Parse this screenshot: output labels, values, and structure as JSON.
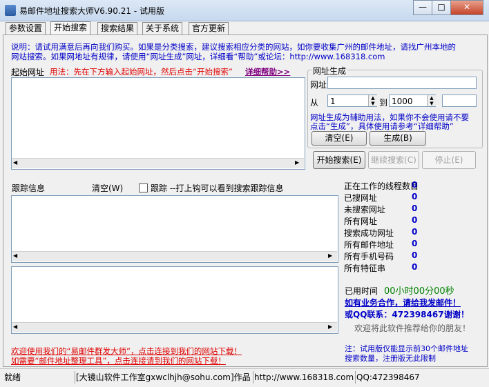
{
  "window": {
    "title": "易邮件地址搜索大师V6.90.21 - 试用版",
    "minimize": "—",
    "maximize": "□",
    "close": "✕"
  },
  "tabs": [
    {
      "label": "参数设置"
    },
    {
      "label": "开始搜索"
    },
    {
      "label": "搜索结果"
    },
    {
      "label": "关于系统"
    },
    {
      "label": "官方更新"
    }
  ],
  "notice": {
    "line1": "说明：请试用满意后再向我们购买。如果是分类搜索，建议搜索相应分类的网站，如你要收集广州的邮件地址，请找广州本地的",
    "line2": "网站搜索。如果网地址有规律，请使用“网址生成”网址，详细看“帮助”或论坛：http://www.168318.com"
  },
  "start_url": {
    "label": "起始网址",
    "usage": "用法：先在下方输入起始网址，然后点击“开始搜索”",
    "help_link": "详细帮助>>"
  },
  "url_gen": {
    "group_title": "网址生成",
    "url_label": "网址",
    "url_value": "",
    "from_label": "从",
    "from_value": "1",
    "to_label": "到",
    "to_value": "1000",
    "extra_value": "",
    "hint1": "网址生成为辅助用法，如果你不会使用请不要",
    "hint2": "点击“生成”，具体使用请参考“详细帮助”",
    "clear_btn": "清空(E)",
    "gen_btn": "生成(B)"
  },
  "controls": {
    "start_btn": "开始搜索(E)",
    "continue_btn": "继续搜索(C)",
    "stop_btn": "停止(E)"
  },
  "trace": {
    "label": "跟踪信息",
    "clear": "清空(W)",
    "checkbox_label": "跟踪 --打上钩可以看到搜索跟踪信息",
    "checked": false
  },
  "counters": [
    {
      "label": "正在工作的线程数目",
      "value": "0"
    },
    {
      "label": "已搜网址",
      "value": "0"
    },
    {
      "label": "未搜索网址",
      "value": "0"
    },
    {
      "label": "所有网址",
      "value": "0"
    },
    {
      "label": "搜索成功网址",
      "value": "0"
    },
    {
      "label": "所有邮件地址",
      "value": "0"
    },
    {
      "label": "所有手机号码",
      "value": "0"
    },
    {
      "label": "所有特征串",
      "value": "0"
    }
  ],
  "elapsed": {
    "label": "已用时间",
    "value": "00小时00分00秒"
  },
  "promo": {
    "business": "如有业务合作，请给我发邮件！",
    "qq": "或QQ联系：472398467",
    "thanks": "谢谢！",
    "recommend": "欢迎将此软件推荐给你的朋友！",
    "trial_line1": "注：试用版仅能显示前30个邮件地址",
    "trial_line2": "搜索数量，注册版无此限制"
  },
  "footer_links": {
    "line1": "欢迎使用我们的“易邮件群发大师”，点击连接到我们的网站下载！",
    "line2": "如需要“邮件地址整理工具”，点击连接请到我们的网站下载！"
  },
  "statusbar": {
    "state": "就绪",
    "author": "[大镜山软件工作室gxwclhjh@sohu.com]作品",
    "site": "http://www.168318.com",
    "qq": "QQ:472398467"
  },
  "colors": {
    "accent_blue": "#0000c8",
    "link_red": "#e00000",
    "count_green": "#008000"
  }
}
